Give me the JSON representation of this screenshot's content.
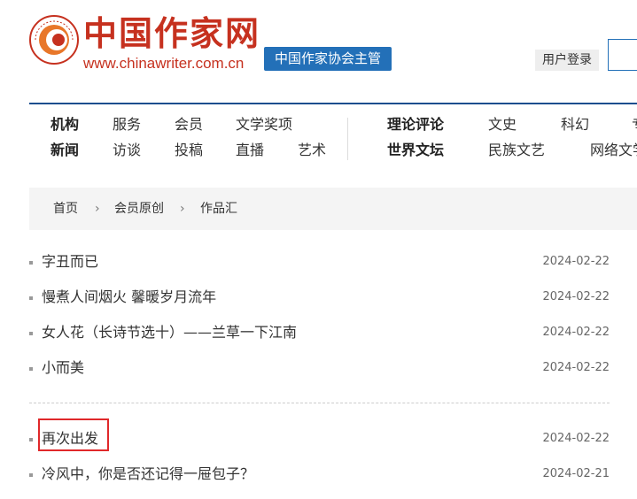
{
  "header": {
    "logo_title": "中国作家网",
    "logo_url": "www.chinawriter.com.cn",
    "host_badge": "中国作家协会主管",
    "login": "用户登录"
  },
  "nav": {
    "row1": [
      "机构",
      "服务",
      "会员",
      "文学奖项",
      "理论评论",
      "文史",
      "科幻",
      "专"
    ],
    "row2": [
      "新闻",
      "访谈",
      "投稿",
      "直播",
      "艺术",
      "世界文坛",
      "民族文艺",
      "网络文学"
    ]
  },
  "breadcrumb": [
    "首页",
    "会员原创",
    "作品汇"
  ],
  "list": [
    {
      "title": "字丑而已",
      "date": "2024-02-22"
    },
    {
      "title": "慢煮人间烟火 馨暖岁月流年",
      "date": "2024-02-22"
    },
    {
      "title": "女人花（长诗节选十）——兰草一下江南",
      "date": "2024-02-22"
    },
    {
      "title": "小而美",
      "date": "2024-02-22"
    },
    {
      "title": "再次出发",
      "date": "2024-02-22"
    },
    {
      "title": "冷风中，你是否还记得一屉包子？",
      "date": "2024-02-21"
    }
  ],
  "colors": {
    "brand_red": "#c6311f",
    "brand_blue": "#2370b8",
    "highlight": "#e0282a"
  }
}
